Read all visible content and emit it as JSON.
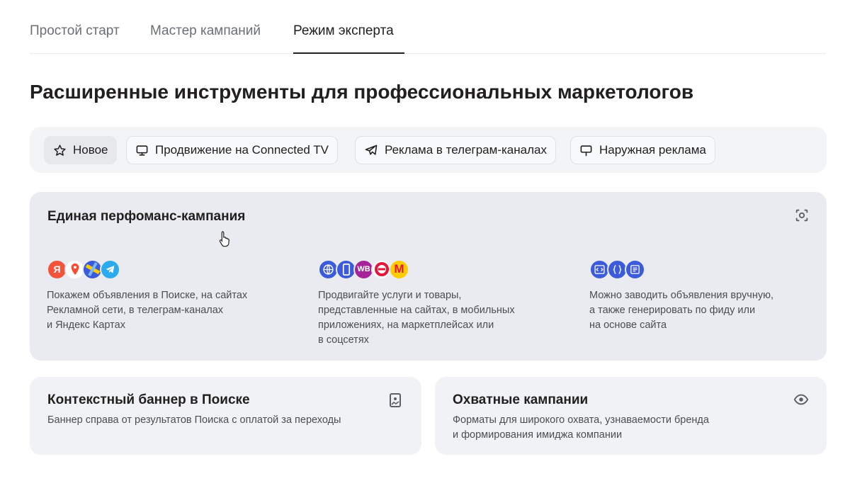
{
  "tabs": [
    {
      "label": "Простой старт",
      "active": false
    },
    {
      "label": "Мастер кампаний",
      "active": false
    },
    {
      "label": "Режим эксперта",
      "active": true
    }
  ],
  "page_title": "Расширенные инструменты для профессиональных маркетологов",
  "chips": [
    {
      "label": "Новое",
      "icon": "star-icon",
      "active": true
    },
    {
      "label": "Продвижение на Connected TV",
      "icon": "tv-icon",
      "active": false
    },
    {
      "label": "Реклама в телеграм-каналах",
      "icon": "telegram-icon",
      "active": false
    },
    {
      "label": "Наружная реклама",
      "icon": "billboard-icon",
      "active": false
    }
  ],
  "performance_card": {
    "title": "Единая перфоманс-кампания",
    "icon": "focus-icon",
    "columns": [
      {
        "icons": [
          "yandex-search-icon",
          "yandex-maps-pin-icon",
          "ad-network-icon",
          "telegram-icon"
        ],
        "lines": [
          "Покажем объявления в Поиске, на сайтах",
          "Рекламной сети, в телеграм-каналах",
          "и Яндекс Картах"
        ]
      },
      {
        "icons": [
          "globe-icon",
          "mobile-app-icon",
          "wildberries-icon",
          "sbermegamarket-icon",
          "yandex-market-icon"
        ],
        "icon_texts": {
          "wildberries-icon": "WB",
          "yandex-market-icon": "M"
        },
        "lines": [
          "Продвигайте услуги и товары,",
          "представленные на сайтах, в мобильных",
          "приложениях, на маркетплейсах или",
          "в соцсетях"
        ]
      },
      {
        "icons": [
          "code-icon",
          "feed-icon",
          "page-icon"
        ],
        "lines": [
          "Можно заводить объявления вручную,",
          "а также генерировать по фиду или",
          "на основе сайта"
        ]
      }
    ]
  },
  "banner_card": {
    "title": "Контекстный баннер в Поиске",
    "description": "Баннер справа от результатов Поиска с оплатой за переходы",
    "icon": "image-icon"
  },
  "reach_card": {
    "title": "Охватные кампании",
    "lines": [
      "Форматы для широкого охвата, узнаваемости бренда",
      "и формирования имиджа компании"
    ],
    "icon": "eye-icon"
  },
  "colors": {
    "yandex_red": "#f3533b",
    "maps_red": "#fa4b33",
    "telegram_blue": "#2aabee",
    "brand_blue": "#3b5bdb",
    "wb_purple": "#a7239a",
    "market_yellow": "#ffcc00"
  }
}
